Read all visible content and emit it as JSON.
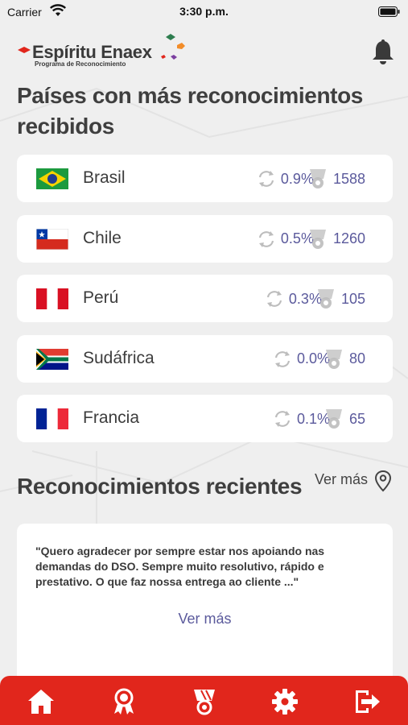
{
  "status_bar": {
    "carrier": "Carrier",
    "time": "3:30 p.m."
  },
  "header": {
    "brand": "Espíritu Enaex",
    "tagline": "Programa de Reconocimiento",
    "icons": {
      "notifications": "bell-icon"
    }
  },
  "countries_section": {
    "title": "Países con más reconocimientos recibidos",
    "items": [
      {
        "name": "Brasil",
        "flag": "brazil-flag",
        "percent": "0.9%",
        "count": "1588"
      },
      {
        "name": "Chile",
        "flag": "chile-flag",
        "percent": "0.5%",
        "count": "1260"
      },
      {
        "name": "Perú",
        "flag": "peru-flag",
        "percent": "0.3%",
        "count": "105"
      },
      {
        "name": "Sudáfrica",
        "flag": "south-africa-flag",
        "percent": "0.0%",
        "count": "80"
      },
      {
        "name": "Francia",
        "flag": "france-flag",
        "percent": "0.1%",
        "count": "65"
      }
    ]
  },
  "recent_section": {
    "title": "Reconocimientos recientes",
    "see_more": "Ver más",
    "quote": "\"Quero agradecer por sempre estar nos apoiando nas demandas do DSO. Sempre muito resolutivo, rápido e prestativo. O que faz nossa entrega ao cliente ...\"",
    "card_link": "Ver más"
  },
  "bottom_nav": {
    "items": [
      "home-icon",
      "award-icon",
      "medal-icon",
      "settings-icon",
      "logout-icon"
    ]
  },
  "colors": {
    "accent": "#e1261c",
    "value_text": "#5b5a9c",
    "background": "#efefef"
  }
}
